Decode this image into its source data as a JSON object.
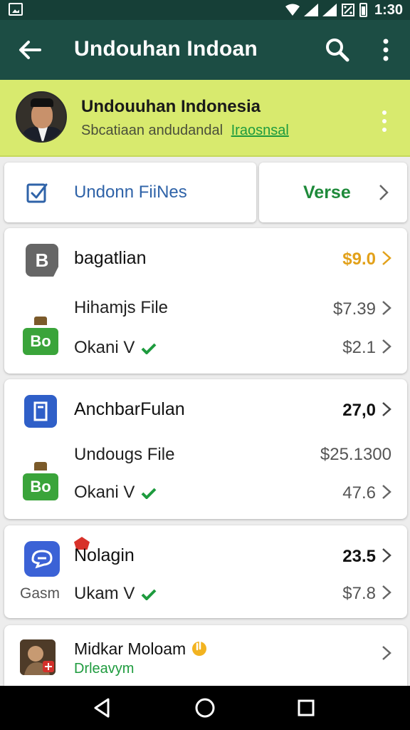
{
  "status_bar": {
    "time": "1:30"
  },
  "app_bar": {
    "title": "Undouhan Indoan"
  },
  "profile": {
    "name": "Undouuhan Indonesia",
    "subtitle": "Sbcatiaan andudandal",
    "link": "Iraosnsal"
  },
  "tabs": {
    "files_label": "Undonn FiiNes",
    "verse_label": "Verse"
  },
  "cards": [
    {
      "title": "bagatlian",
      "title_price": "$9.0",
      "sub_title": "Hihamjs File",
      "sub_price": "$7.39",
      "icon_letter": "B",
      "badge": "Bo",
      "status": "Okani V",
      "status_price": "$2.1"
    },
    {
      "title": "AnchbarFulan",
      "title_price": "27,0",
      "sub_title": "Undougs File",
      "sub_price": "$25.1300",
      "badge": "Bo",
      "status": "Okani V",
      "status_price": "47.6"
    },
    {
      "title": "Nolagin",
      "title_price": "23.5",
      "label": "Gasm",
      "status": "Ukam V",
      "status_price": "$7.8"
    },
    {
      "title": "Midkar Moloam",
      "subtitle": "Drleavym"
    }
  ],
  "colors": {
    "app_bar": "#1c4d44",
    "status_bar": "#163f37",
    "profile_bg": "#d8ea6e",
    "accent_green": "#1e8a3a",
    "link_blue": "#2f63a8",
    "price_orange": "#e2a11a"
  }
}
